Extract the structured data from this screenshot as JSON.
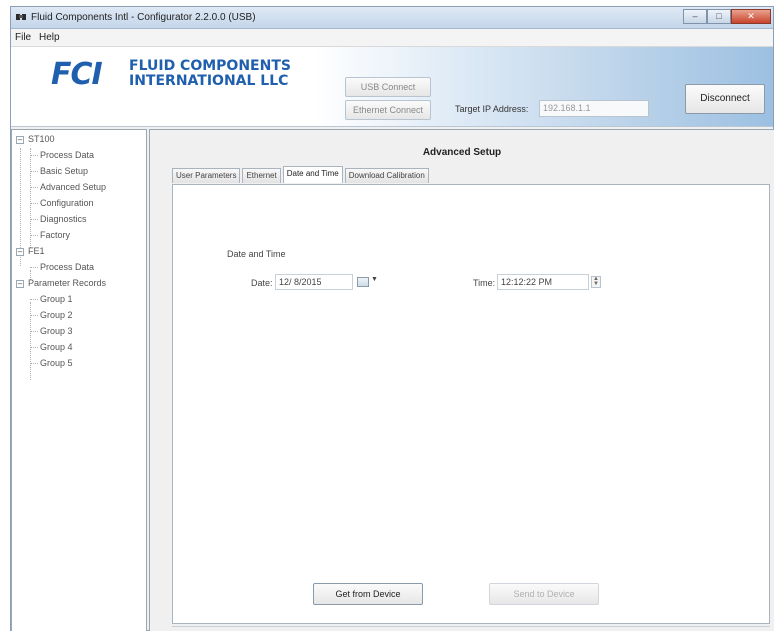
{
  "window": {
    "title": "Fluid Components Intl - Configurator 2.2.0.0 (USB)",
    "controls": [
      "minimize-icon",
      "maximize-icon",
      "close-icon"
    ]
  },
  "menu": {
    "file": "File",
    "help": "Help"
  },
  "banner": {
    "logo_mark": "FCI",
    "logo_line1": "FLUID COMPONENTS",
    "logo_line2": "INTERNATIONAL LLC",
    "usb_connect": "USB Connect",
    "ethernet_connect": "Ethernet Connect",
    "target_ip_label": "Target IP Address:",
    "target_ip_value": "192.168.1.1",
    "disconnect": "Disconnect"
  },
  "tree": {
    "st100": "ST100",
    "process_data": "Process Data",
    "basic_setup": "Basic Setup",
    "advanced_setup": "Advanced Setup",
    "configuration": "Configuration",
    "diagnostics": "Diagnostics",
    "factory": "Factory",
    "fe1": "FE1",
    "fe1_process_data": "Process Data",
    "parameter_records": "Parameter Records",
    "group1": "Group 1",
    "group2": "Group 2",
    "group3": "Group 3",
    "group4": "Group 4",
    "group5": "Group 5"
  },
  "content": {
    "section_title": "Advanced Setup",
    "tabs": {
      "user_parameters": "User Parameters",
      "ethernet": "Ethernet",
      "date_and_time": "Date and Time",
      "download_calibration": "Download Calibration"
    },
    "group_label": "Date and Time",
    "date_label": "Date:",
    "date_value": "12/ 8/2015",
    "time_label": "Time:",
    "time_value": "12:12:22 PM",
    "get_from_device": "Get from Device",
    "send_to_device": "Send to Device"
  },
  "colors": {
    "brand_blue": "#1f5fae",
    "close_red": "#c8442c"
  }
}
